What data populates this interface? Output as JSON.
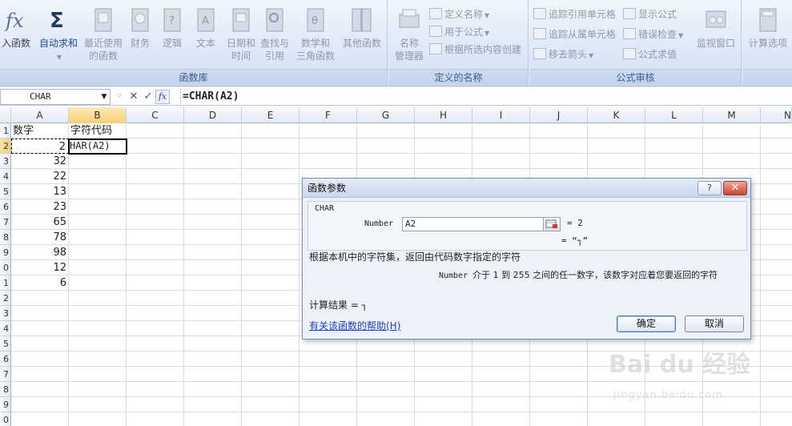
{
  "ribbon": {
    "groups": [
      {
        "label": "函数库"
      },
      {
        "label": "定义的名称"
      },
      {
        "label": "公式审核"
      }
    ],
    "library": {
      "insert_function": "入函数",
      "autosum": "自动求和",
      "recent": [
        "最近使用",
        "的函数"
      ],
      "financial": "财务",
      "logical": "逻辑",
      "text": "文本",
      "datetime": [
        "日期和",
        "时间"
      ],
      "lookup": [
        "查找与",
        "引用"
      ],
      "math": [
        "数学和",
        "三角函数"
      ],
      "more": "其他函数"
    },
    "names": {
      "name_manager": [
        "名称",
        "管理器"
      ],
      "define_name": "定义名称",
      "use_in_formula": "用于公式",
      "create_from_selection": "根据所选内容创建"
    },
    "audit": {
      "trace_precedents": "追踪引用单元格",
      "trace_dependents": "追踪从属单元格",
      "remove_arrows": "移去箭头",
      "show_formulas": "显示公式",
      "error_checking": "错误检查",
      "evaluate_formula": "公式求值",
      "watch_window": "监视窗口"
    },
    "calc": {
      "calc_options": "计算选项"
    }
  },
  "formula_bar": {
    "name_box": "CHAR",
    "formula": "=CHAR(A2)",
    "fx_label": "fx"
  },
  "grid": {
    "columns": [
      "A",
      "B",
      "C",
      "D",
      "E",
      "F",
      "G",
      "H",
      "I",
      "J",
      "K",
      "L",
      "M",
      "N"
    ],
    "rows": [
      "1",
      "2",
      "3",
      "4",
      "5",
      "6",
      "7",
      "8",
      "9",
      "0",
      "1",
      "2",
      "3",
      "4",
      "5",
      "6",
      "7",
      "8",
      "9",
      "0"
    ],
    "a1": "数字",
    "b1": "字符代码",
    "a_values": [
      "2",
      "32",
      "22",
      "13",
      "23",
      "65",
      "78",
      "98",
      "12",
      "6"
    ],
    "b2": "HAR(A2)"
  },
  "dialog": {
    "title": "函数参数",
    "help": "?",
    "close": "✕",
    "function_name": "CHAR",
    "arg_label": "Number",
    "arg_value": "A2",
    "arg_eval": "=  2",
    "result_eval": "=  “┐”",
    "description": "根据本机中的字符集，返回由代码数字指定的字符",
    "arg_desc_name": "Number",
    "arg_desc": "介于 1 到 255 之间的任一数字，该数字对应着您要返回的字符",
    "result": "计算结果 =  ┐",
    "help_link": "有关该函数的帮助(H)",
    "ok": "确定",
    "cancel": "取消"
  },
  "watermark": {
    "logo": "Bai  du 经验",
    "url": "jingyan.baidu.com"
  }
}
